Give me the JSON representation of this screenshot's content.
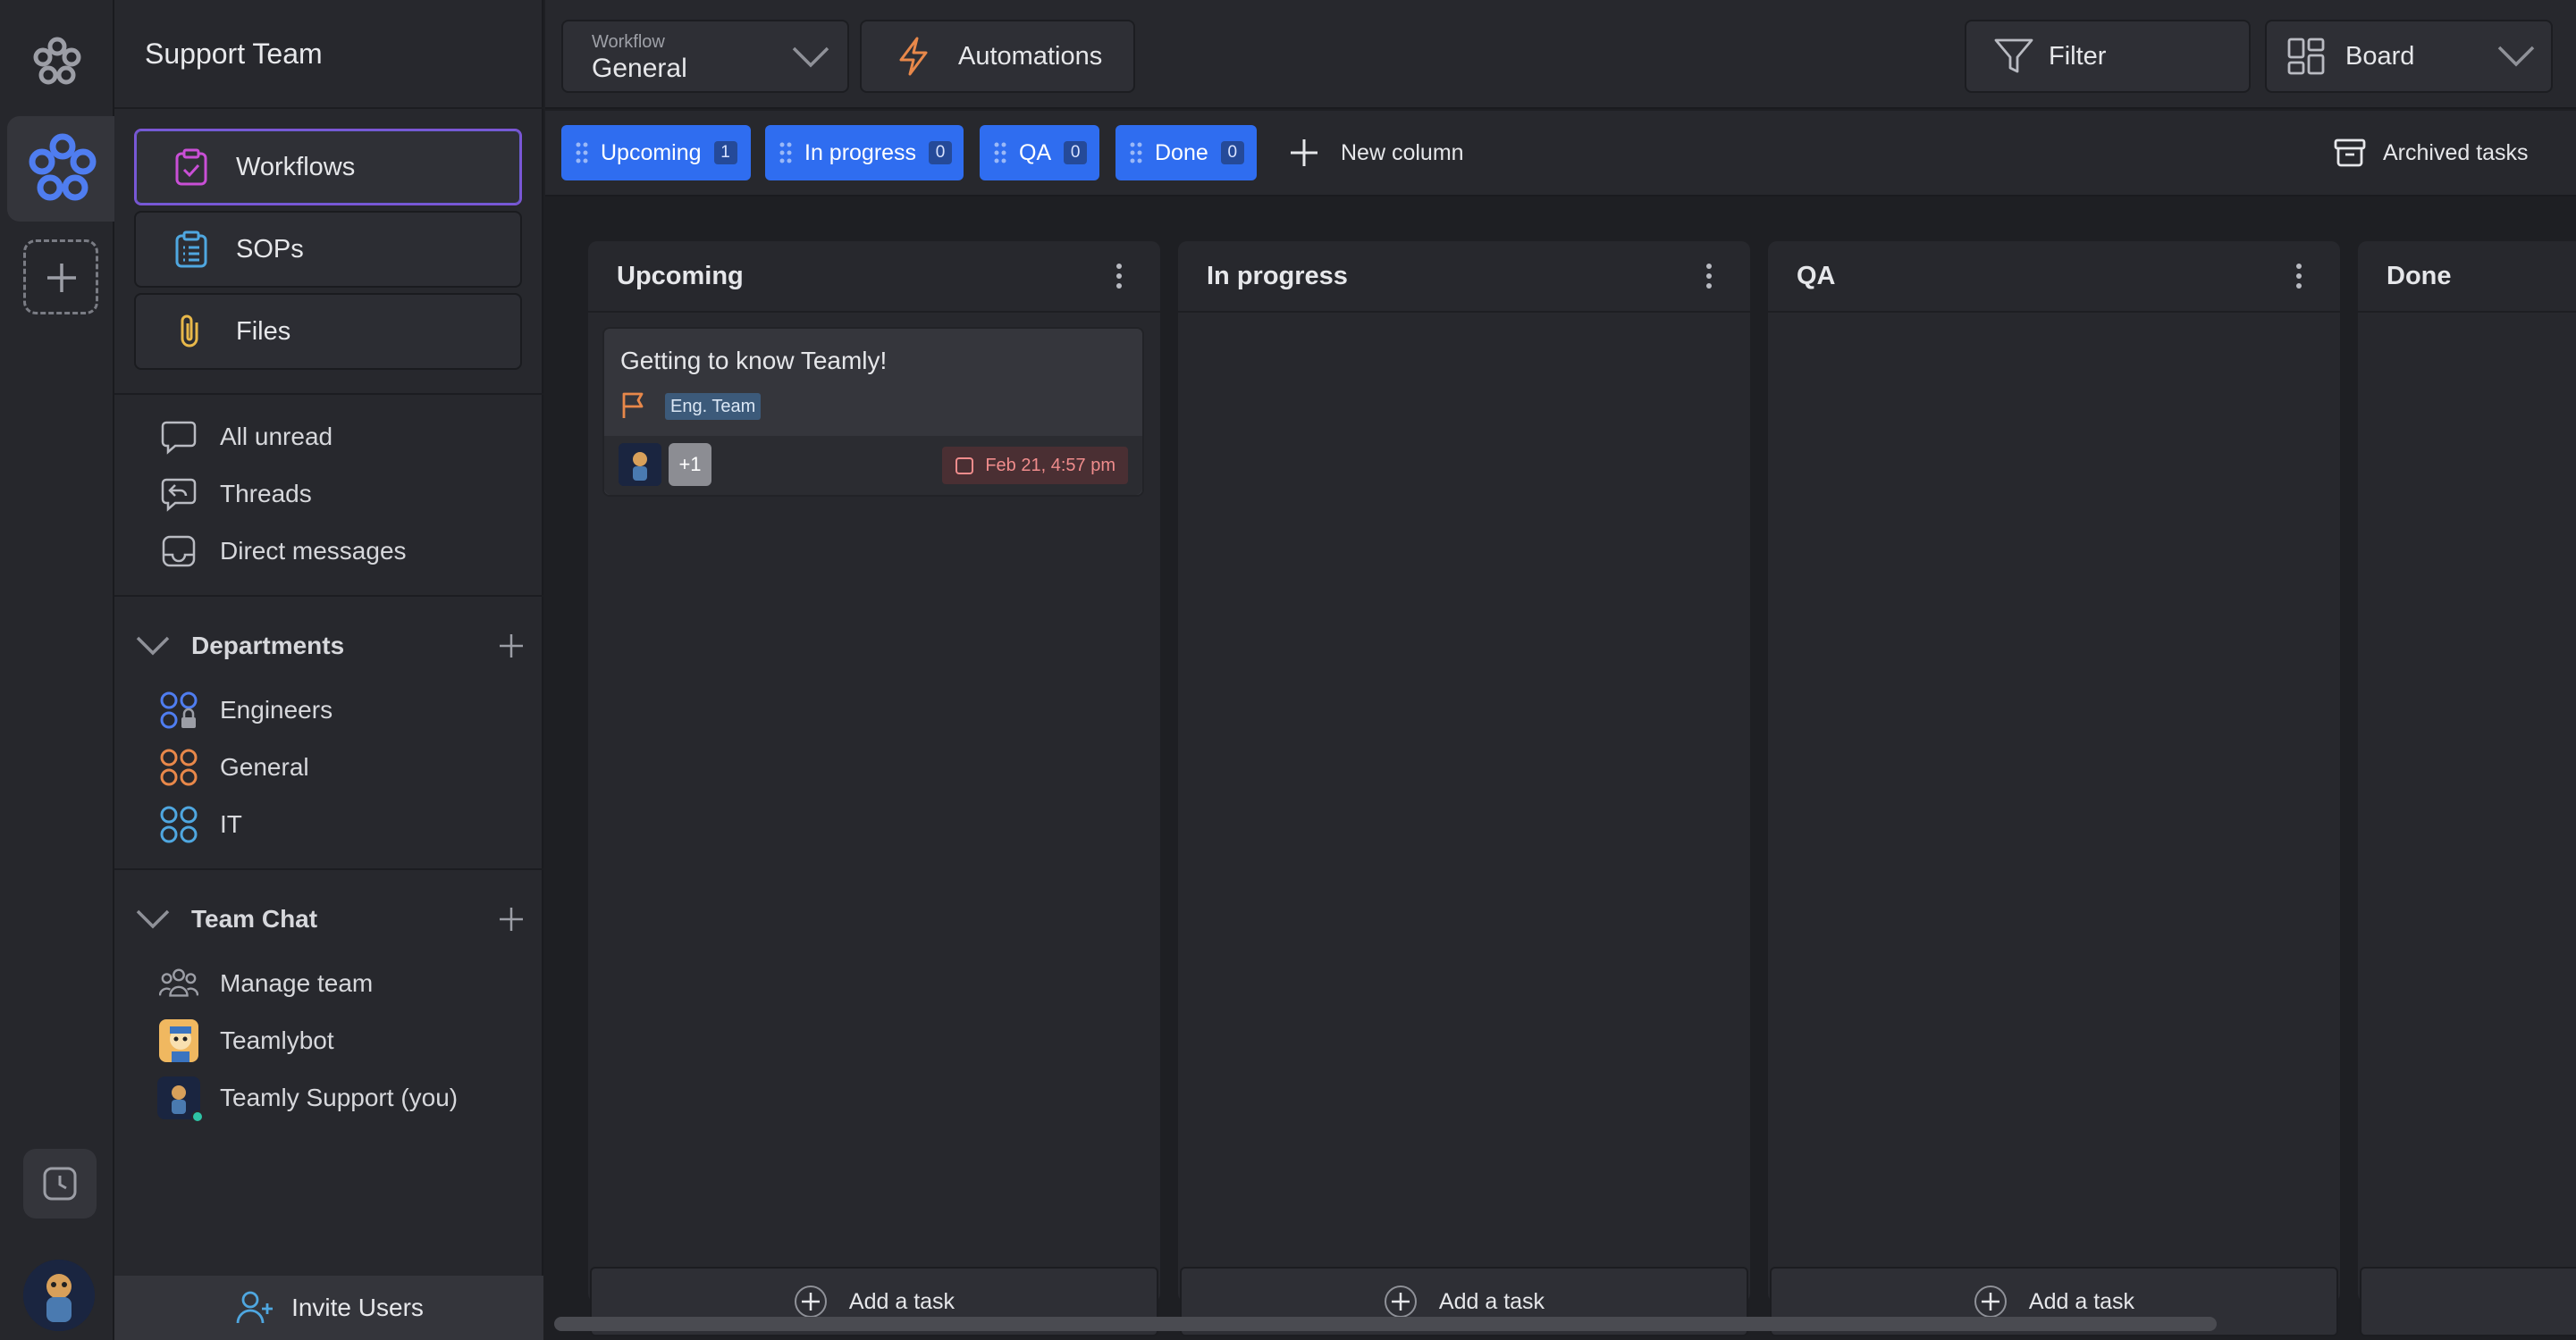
{
  "sidebar": {
    "team_name": "Support Team",
    "nav": [
      {
        "label": "Workflows",
        "icon": "clipboard-check-icon",
        "active": true
      },
      {
        "label": "SOPs",
        "icon": "clipboard-list-icon",
        "active": false
      },
      {
        "label": "Files",
        "icon": "paperclip-icon",
        "active": false
      }
    ],
    "inbox": [
      {
        "label": "All unread",
        "icon": "chat-bubble-icon"
      },
      {
        "label": "Threads",
        "icon": "reply-icon"
      },
      {
        "label": "Direct messages",
        "icon": "inbox-icon"
      }
    ],
    "departments": {
      "title": "Departments",
      "items": [
        {
          "label": "Engineers",
          "icon": "locked-group-icon",
          "color": "#4f7df0"
        },
        {
          "label": "General",
          "icon": "group-icon",
          "color": "#e8884a"
        },
        {
          "label": "IT",
          "icon": "group-icon",
          "color": "#4fa7e0"
        }
      ]
    },
    "team_chat": {
      "title": "Team Chat",
      "items": [
        {
          "label": "Manage team",
          "icon": "team-icon"
        },
        {
          "label": "Teamlybot",
          "icon": "bot-avatar"
        },
        {
          "label": "Teamly Support (you)",
          "icon": "user-avatar"
        }
      ]
    },
    "invite_label": "Invite Users"
  },
  "topbar": {
    "workflow_caption": "Workflow",
    "workflow_value": "General",
    "automations_label": "Automations",
    "filter_label": "Filter",
    "view_label": "Board"
  },
  "columns_bar": {
    "pills": [
      {
        "label": "Upcoming",
        "count": "1"
      },
      {
        "label": "In progress",
        "count": "0"
      },
      {
        "label": "QA",
        "count": "0"
      },
      {
        "label": "Done",
        "count": "0"
      }
    ],
    "new_column_label": "New column",
    "archived_label": "Archived tasks"
  },
  "board": {
    "columns": [
      {
        "title": "Upcoming",
        "add_label": "Add a task"
      },
      {
        "title": "In progress",
        "add_label": "Add a task"
      },
      {
        "title": "QA",
        "add_label": "Add a task"
      },
      {
        "title": "Done",
        "add_label": ""
      }
    ],
    "card": {
      "title": "Getting to know Teamly!",
      "tag": "Eng. Team",
      "extra_assignees": "+1",
      "due": "Feb 21, 4:57 pm"
    }
  },
  "colors": {
    "accent_blue": "#2f6df0",
    "active_border": "#7c56d6",
    "due_text": "#f08c8c",
    "flag": "#e8884a"
  }
}
